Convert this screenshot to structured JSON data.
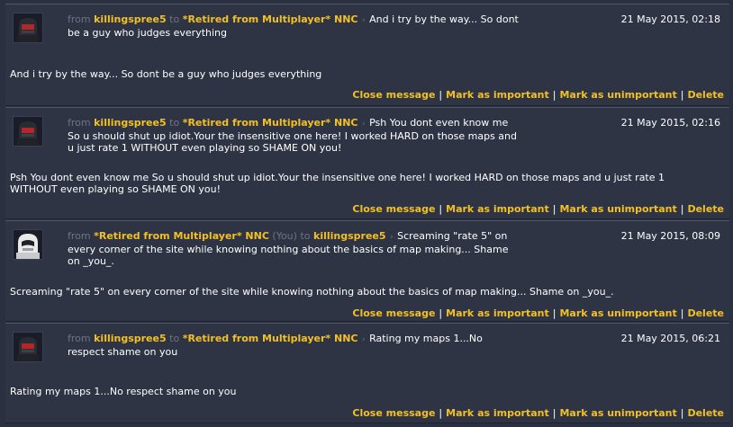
{
  "messages": [
    {
      "from_word": "from",
      "to_word": "to",
      "sender": "killingspree5",
      "sender_you": "",
      "recipient": "*Retired from Multiplayer* NNC",
      "recipient_you": "",
      "separator": "›",
      "preview": "And i try by the way... So dont be a guy who judges everything",
      "date": "21 May 2015, 02:18",
      "body": "And i try by the way... So dont be a guy who judges everything",
      "avatar": "dark-robot-avatar"
    },
    {
      "from_word": "from",
      "to_word": "to",
      "sender": "killingspree5",
      "sender_you": "",
      "recipient": "*Retired from Multiplayer* NNC",
      "recipient_you": "",
      "separator": "›",
      "preview": "Psh You dont even know me So u should shut up idiot.Your the insensitive one here! I worked HARD on those maps and u just rate 1 WITHOUT even playing so SHAME ON you!",
      "date": "21 May 2015, 02:16",
      "body": "Psh You dont even know me So u should shut up idiot.Your the insensitive one here! I worked HARD on those maps and u just rate 1 WITHOUT even playing so SHAME ON you!",
      "avatar": "dark-robot-avatar"
    },
    {
      "from_word": "from",
      "to_word": "to",
      "sender": "*Retired from Multiplayer* NNC",
      "sender_you": "(You)",
      "recipient": "killingspree5",
      "recipient_you": "",
      "separator": "›",
      "preview": "Screaming \"rate 5\" on every corner of the site while knowing nothing about the basics of map making... Shame on _you_.",
      "date": "21 May 2015, 08:09",
      "body": "Screaming \"rate 5\" on every corner of the site while knowing nothing about the basics of map making... Shame on _you_.",
      "avatar": "white-robot-avatar"
    },
    {
      "from_word": "from",
      "to_word": "to",
      "sender": "killingspree5",
      "sender_you": "",
      "recipient": "*Retired from Multiplayer* NNC",
      "recipient_you": "",
      "separator": "›",
      "preview": "Rating my maps 1...No respect shame on you",
      "date": "21 May 2015, 06:21",
      "body": "Rating my maps 1...No respect shame on you",
      "avatar": "dark-robot-avatar"
    }
  ],
  "actions": {
    "close": "Close message",
    "important": "Mark as important",
    "unimportant": "Mark as unimportant",
    "delete": "Delete",
    "divider": "|"
  },
  "colors": {
    "background": "#2b3040",
    "panel": "#2f3445",
    "username": "#f2c026",
    "muted": "#6d7385",
    "text": "#ffffff"
  }
}
